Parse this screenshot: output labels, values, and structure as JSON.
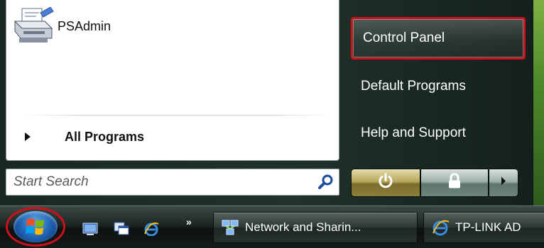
{
  "start_menu": {
    "pinned_programs": [
      {
        "label": "PSAdmin",
        "icon": "printer-icon"
      }
    ],
    "all_programs_label": "All Programs",
    "search": {
      "placeholder": "Start Search",
      "icon": "search-icon"
    },
    "right_items": [
      {
        "label": "Control Panel",
        "highlighted": true
      },
      {
        "label": "Default Programs"
      },
      {
        "label": "Help and Support"
      }
    ],
    "power_buttons": [
      {
        "icon": "power-icon"
      },
      {
        "icon": "lock-icon"
      },
      {
        "icon": "chevron-right-icon"
      }
    ]
  },
  "taskbar": {
    "start_button": {
      "icon": "windows-logo-icon",
      "highlighted": true
    },
    "quick_launch": [
      "show-desktop-icon",
      "switch-windows-icon",
      "internet-explorer-icon"
    ],
    "overflow_label": "»",
    "tasks": [
      {
        "label": "Network and Sharin...",
        "icon": "network-icon"
      },
      {
        "label": "TP-LINK AD",
        "icon": "internet-explorer-icon"
      }
    ]
  },
  "colors": {
    "highlight_red": "#d0101a",
    "right_pane_bg": "#1e2e27",
    "left_pane_bg": "#ffffff"
  }
}
